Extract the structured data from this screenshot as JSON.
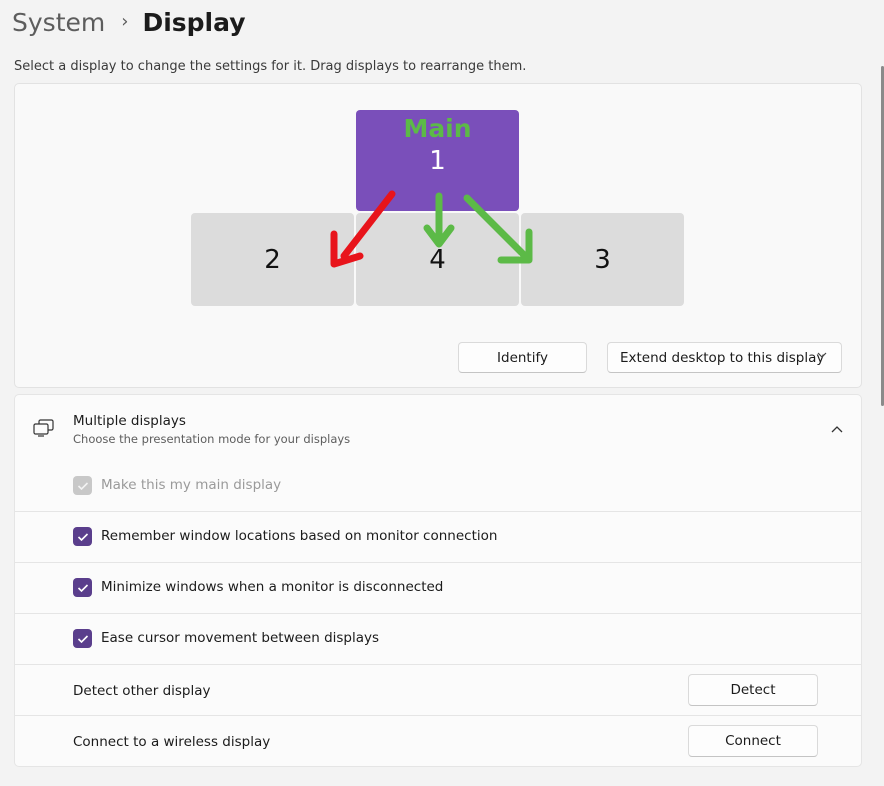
{
  "breadcrumb": {
    "parent": "System",
    "separator": "›",
    "current": "Display"
  },
  "instruction": "Select a display to change the settings for it. Drag displays to rearrange them.",
  "arrangement": {
    "main_label": "Main",
    "monitors": [
      {
        "number": "1",
        "selected": true
      },
      {
        "number": "2",
        "selected": false
      },
      {
        "number": "4",
        "selected": false
      },
      {
        "number": "3",
        "selected": false
      }
    ],
    "identify_label": "Identify",
    "mode_select_value": "Extend desktop to this display"
  },
  "multiple_displays": {
    "title": "Multiple displays",
    "subtitle": "Choose the presentation mode for your displays",
    "options": [
      {
        "label": "Make this my main display",
        "checked": true,
        "disabled": true
      },
      {
        "label": "Remember window locations based on monitor connection",
        "checked": true,
        "disabled": false
      },
      {
        "label": "Minimize windows when a monitor is disconnected",
        "checked": true,
        "disabled": false
      },
      {
        "label": "Ease cursor movement between displays",
        "checked": true,
        "disabled": false
      }
    ],
    "detect": {
      "label": "Detect other display",
      "button": "Detect"
    },
    "wireless": {
      "label": "Connect to a wireless display",
      "button": "Connect"
    }
  },
  "colors": {
    "accent": "#7a4fba",
    "checkbox": "#5a3e8c",
    "annotation_green": "#5cba47",
    "annotation_red": "#e8141b"
  }
}
